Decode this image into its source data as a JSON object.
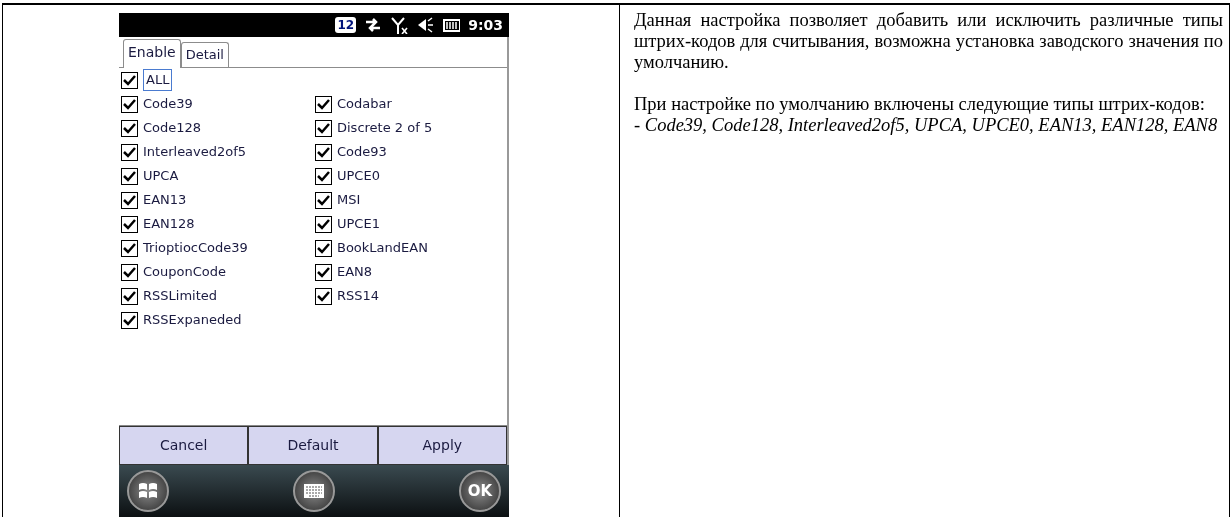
{
  "device_screen": {
    "status_bar": {
      "badge": "12",
      "time": "9:03"
    },
    "tabs": [
      {
        "label": "Enable",
        "selected": true
      },
      {
        "label": "Detail",
        "selected": false
      }
    ],
    "all_option": {
      "label": "ALL",
      "checked": true
    },
    "barcode_types": [
      {
        "label": "Code39",
        "checked": true
      },
      {
        "label": "Codabar",
        "checked": true
      },
      {
        "label": "Code128",
        "checked": true
      },
      {
        "label": "Discrete 2 of 5",
        "checked": true
      },
      {
        "label": "Interleaved2of5",
        "checked": true
      },
      {
        "label": "Code93",
        "checked": true
      },
      {
        "label": "UPCA",
        "checked": true
      },
      {
        "label": "UPCE0",
        "checked": true
      },
      {
        "label": "EAN13",
        "checked": true
      },
      {
        "label": "MSI",
        "checked": true
      },
      {
        "label": "EAN128",
        "checked": true
      },
      {
        "label": "UPCE1",
        "checked": true
      },
      {
        "label": "TrioptiocCode39",
        "checked": true
      },
      {
        "label": "BookLandEAN",
        "checked": true
      },
      {
        "label": "CouponCode",
        "checked": true
      },
      {
        "label": "EAN8",
        "checked": true
      },
      {
        "label": "RSSLimited",
        "checked": true
      },
      {
        "label": "RSS14",
        "checked": true
      },
      {
        "label": "RSSExpaneded",
        "checked": true
      }
    ],
    "buttons": [
      "Cancel",
      "Default",
      "Apply"
    ],
    "soft_keys": {
      "ok": "OK"
    }
  },
  "description": {
    "paragraphs": [
      "Данная настройка позволяет добавить или исключить различные типы штрих-кодов для считывания, возможна установка заводского значения по умолчанию.",
      "При настройке по умолчанию включены следующие типы штрих-кодов:"
    ],
    "default_list": "- Code39, Code128, Interleaved2of5, UPCA, UPCE0, EAN13, EAN128, EAN8"
  }
}
